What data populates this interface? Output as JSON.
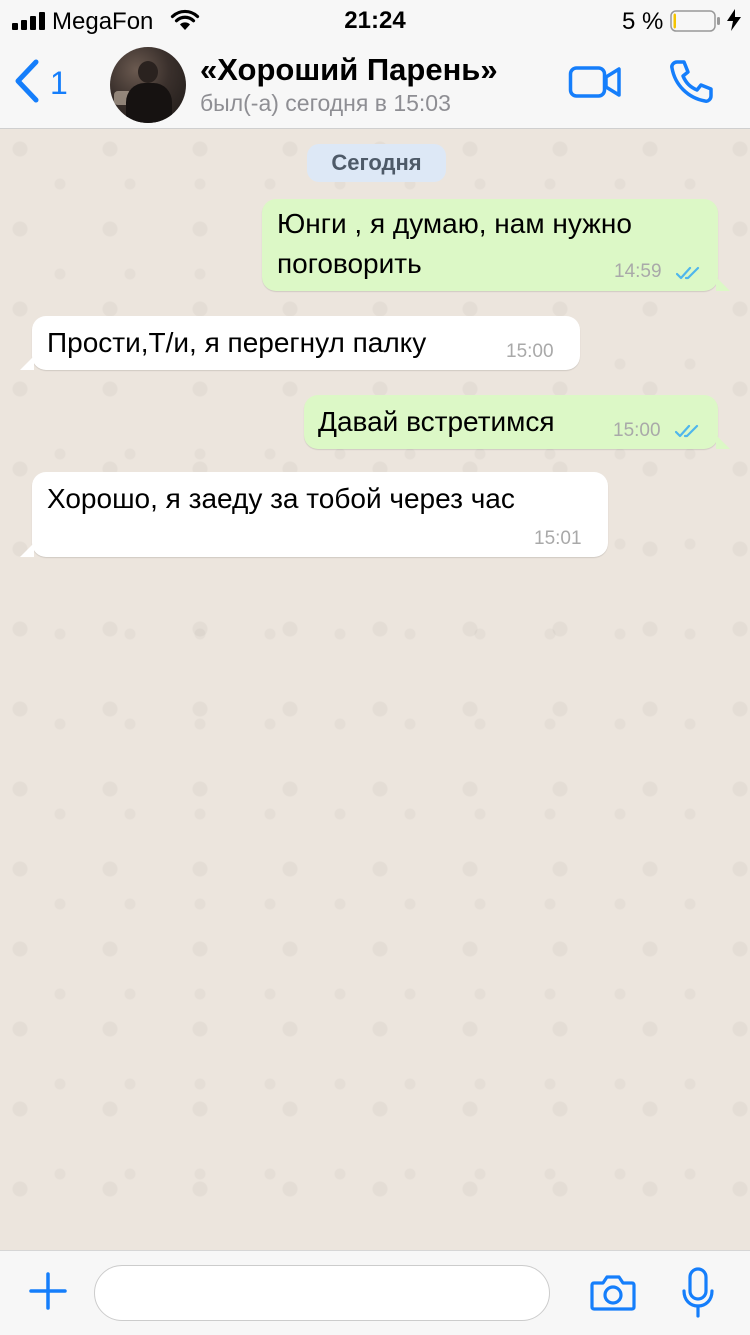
{
  "status_bar": {
    "carrier": "MegaFon",
    "time": "21:24",
    "battery_percent": "5 %",
    "battery_level": 0.05
  },
  "header": {
    "back_count": "1",
    "contact_name": "«Хороший Парень»",
    "last_seen": "был(-а) сегодня в 15:03",
    "icons": [
      "chevron-left-icon",
      "video-call-icon",
      "phone-icon"
    ]
  },
  "chat": {
    "date_label": "Сегодня",
    "messages": [
      {
        "direction": "outgoing",
        "lines": [
          "Юнги , я думаю, нам нужно",
          "поговорить"
        ],
        "time": "14:59",
        "status": "read"
      },
      {
        "direction": "incoming",
        "lines": [
          "Прости,Т/и, я перегнул палку"
        ],
        "time": "15:00"
      },
      {
        "direction": "outgoing",
        "lines": [
          "Давай встретимся"
        ],
        "time": "15:00",
        "status": "read"
      },
      {
        "direction": "incoming",
        "lines": [
          "Хорошо, я заеду за тобой через час"
        ],
        "time": "15:01"
      }
    ]
  },
  "input_bar": {
    "placeholder": "",
    "value": "",
    "icons": [
      "plus-icon",
      "camera-icon",
      "microphone-icon"
    ]
  },
  "colors": {
    "accent": "#157efb",
    "outgoing_bubble": "#dcf8c6",
    "incoming_bubble": "#ffffff",
    "chat_background": "#ece5dd",
    "read_ticks": "#4fb6ec",
    "date_chip": "#dde8f6"
  }
}
